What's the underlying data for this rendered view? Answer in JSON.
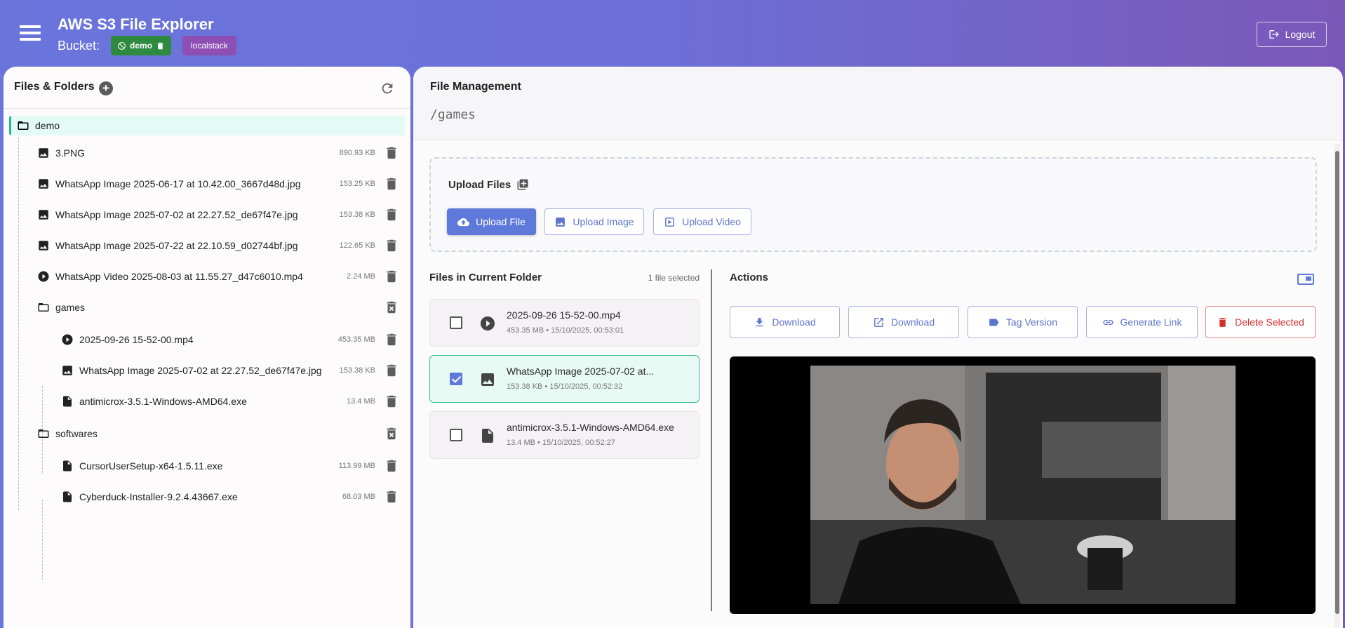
{
  "header": {
    "title": "AWS S3 File Explorer",
    "bucket_label": "Bucket:",
    "bucket_name": "demo",
    "environment": "localstack",
    "logout_label": "Logout"
  },
  "tree": {
    "title": "Files & Folders",
    "root": "demo",
    "items": [
      {
        "label": "3.PNG",
        "size": "890.93 KB",
        "icon": "image-icon"
      },
      {
        "label": "WhatsApp Image 2025-06-17 at 10.42.00_3667d48d.jpg",
        "size": "153.25 KB",
        "icon": "image-icon"
      },
      {
        "label": "WhatsApp Image 2025-07-02 at 22.27.52_de67f47e.jpg",
        "size": "153.38 KB",
        "icon": "image-icon"
      },
      {
        "label": "WhatsApp Image 2025-07-22 at 22.10.59_d02744bf.jpg",
        "size": "122.65 KB",
        "icon": "image-icon"
      },
      {
        "label": "WhatsApp Video 2025-08-03 at 11.55.27_d47c6010.mp4",
        "size": "2.24 MB",
        "icon": "video-icon"
      },
      {
        "label": "games",
        "size": "",
        "icon": "folder-icon"
      },
      {
        "label": "2025-09-26 15-52-00.mp4",
        "size": "453.35 MB",
        "icon": "video-icon"
      },
      {
        "label": "WhatsApp Image 2025-07-02 at 22.27.52_de67f47e.jpg",
        "size": "153.38 KB",
        "icon": "image-icon"
      },
      {
        "label": "antimicrox-3.5.1-Windows-AMD64.exe",
        "size": "13.4 MB",
        "icon": "file-icon"
      },
      {
        "label": "softwares",
        "size": "",
        "icon": "folder-icon"
      },
      {
        "label": "CursorUserSetup-x64-1.5.11.exe",
        "size": "113.99 MB",
        "icon": "file-icon"
      },
      {
        "label": "Cyberduck-Installer-9.2.4.43667.exe",
        "size": "68.03 MB",
        "icon": "file-icon"
      }
    ]
  },
  "main": {
    "title": "File Management",
    "path": "/games",
    "upload": {
      "title": "Upload Files",
      "file_btn": "Upload File",
      "image_btn": "Upload Image",
      "video_btn": "Upload Video"
    },
    "files": {
      "title": "Files in Current Folder",
      "selected_count": "1 file selected",
      "items": [
        {
          "name": "2025-09-26 15-52-00.mp4",
          "meta": "453.35 MB • 15/10/2025, 00:53:01",
          "checked": false
        },
        {
          "name": "WhatsApp Image 2025-07-02 at...",
          "meta": "153.38 KB • 15/10/2025, 00:52:32",
          "checked": true
        },
        {
          "name": "antimicrox-3.5.1-Windows-AMD64.exe",
          "meta": "13.4 MB • 15/10/2025, 00:52:27",
          "checked": false
        }
      ]
    },
    "actions": {
      "title": "Actions",
      "download": "Download",
      "download_open": "Download",
      "tag_version": "Tag Version",
      "generate_link": "Generate Link",
      "delete_selected": "Delete Selected"
    }
  }
}
